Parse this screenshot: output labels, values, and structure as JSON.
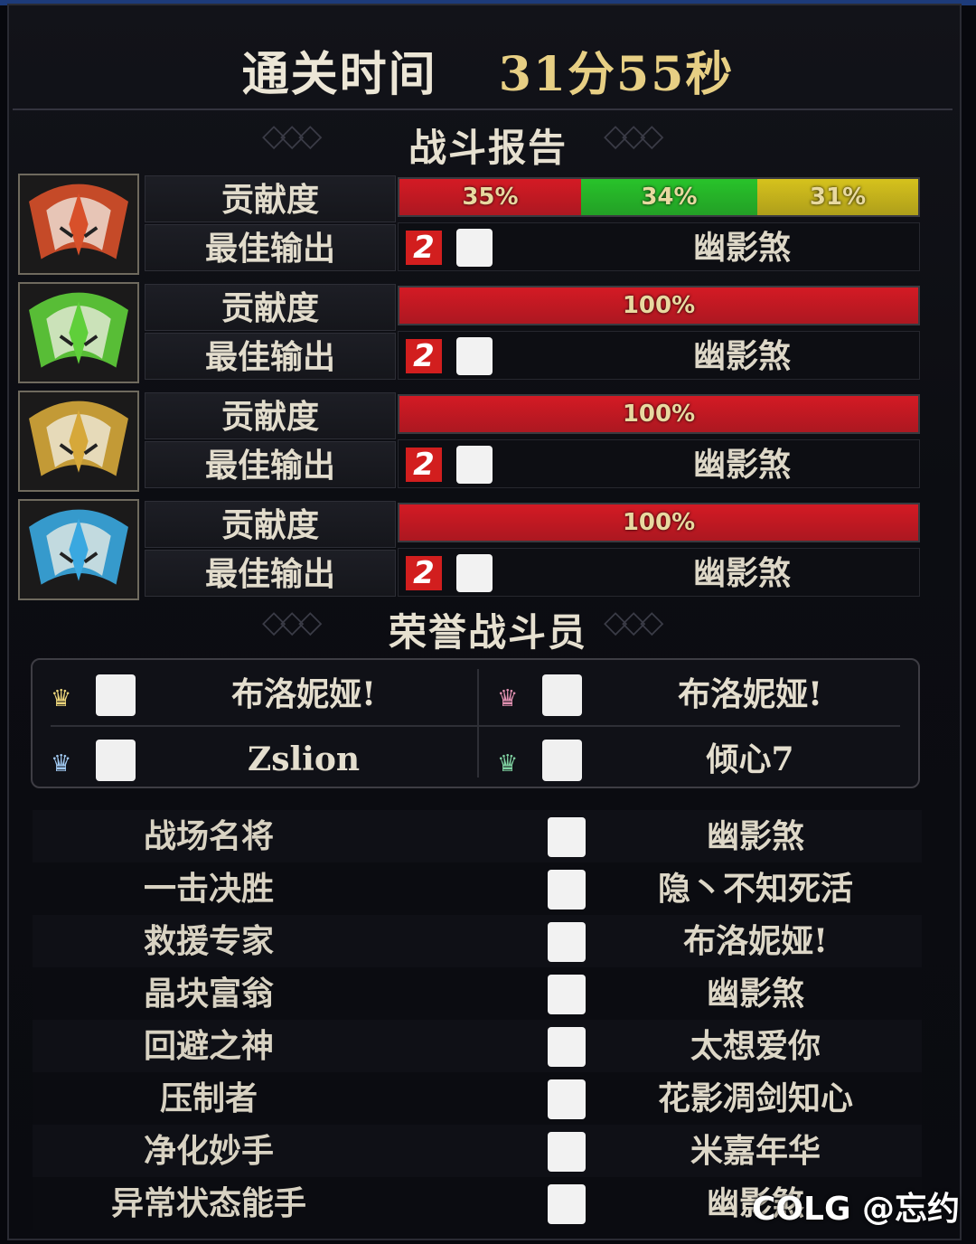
{
  "header": {
    "clear_time_label": "通关时间",
    "clear_time_value": "31分55秒"
  },
  "battle_report": {
    "title": "战斗报告",
    "contribution_label": "贡献度",
    "best_output_label": "最佳输出",
    "players": [
      {
        "crest_color": "#d8502a",
        "contribution": [
          {
            "text": "35%",
            "value": 35,
            "color": "#d41a24"
          },
          {
            "text": "34%",
            "value": 34,
            "color": "#28c32a"
          },
          {
            "text": "31%",
            "value": 31,
            "color": "#d6c21c"
          }
        ],
        "best_badge": "2",
        "best_name": "幽影煞"
      },
      {
        "crest_color": "#5fcf3a",
        "contribution": [
          {
            "text": "100%",
            "value": 100,
            "color": "#d41a24"
          }
        ],
        "best_badge": "2",
        "best_name": "幽影煞"
      },
      {
        "crest_color": "#d6a83a",
        "contribution": [
          {
            "text": "100%",
            "value": 100,
            "color": "#d41a24"
          }
        ],
        "best_badge": "2",
        "best_name": "幽影煞"
      },
      {
        "crest_color": "#3aa8e0",
        "contribution": [
          {
            "text": "100%",
            "value": 100,
            "color": "#d41a24"
          }
        ],
        "best_badge": "2",
        "best_name": "幽影煞"
      }
    ]
  },
  "honor": {
    "title": "荣誉战斗员",
    "members": [
      {
        "name": "布洛妮娅!",
        "crown_color": "#ecd57a"
      },
      {
        "name": "布洛妮娅!",
        "crown_color": "#e090b0"
      },
      {
        "name": "Zslion",
        "crown_color": "#a0c8f0"
      },
      {
        "name": "倾心7",
        "crown_color": "#7fd0a0"
      }
    ]
  },
  "awards": [
    {
      "title": "战场名将",
      "player": "幽影煞"
    },
    {
      "title": "一击决胜",
      "player": "隐丶不知死活"
    },
    {
      "title": "救援专家",
      "player": "布洛妮娅!"
    },
    {
      "title": "晶块富翁",
      "player": "幽影煞"
    },
    {
      "title": "回避之神",
      "player": "太想爱你"
    },
    {
      "title": "压制者",
      "player": "花影凋剑知心"
    },
    {
      "title": "净化妙手",
      "player": "米嘉年华"
    },
    {
      "title": "异常状态能手",
      "player": "幽影煞"
    }
  ],
  "watermark": "COLG @忘约"
}
